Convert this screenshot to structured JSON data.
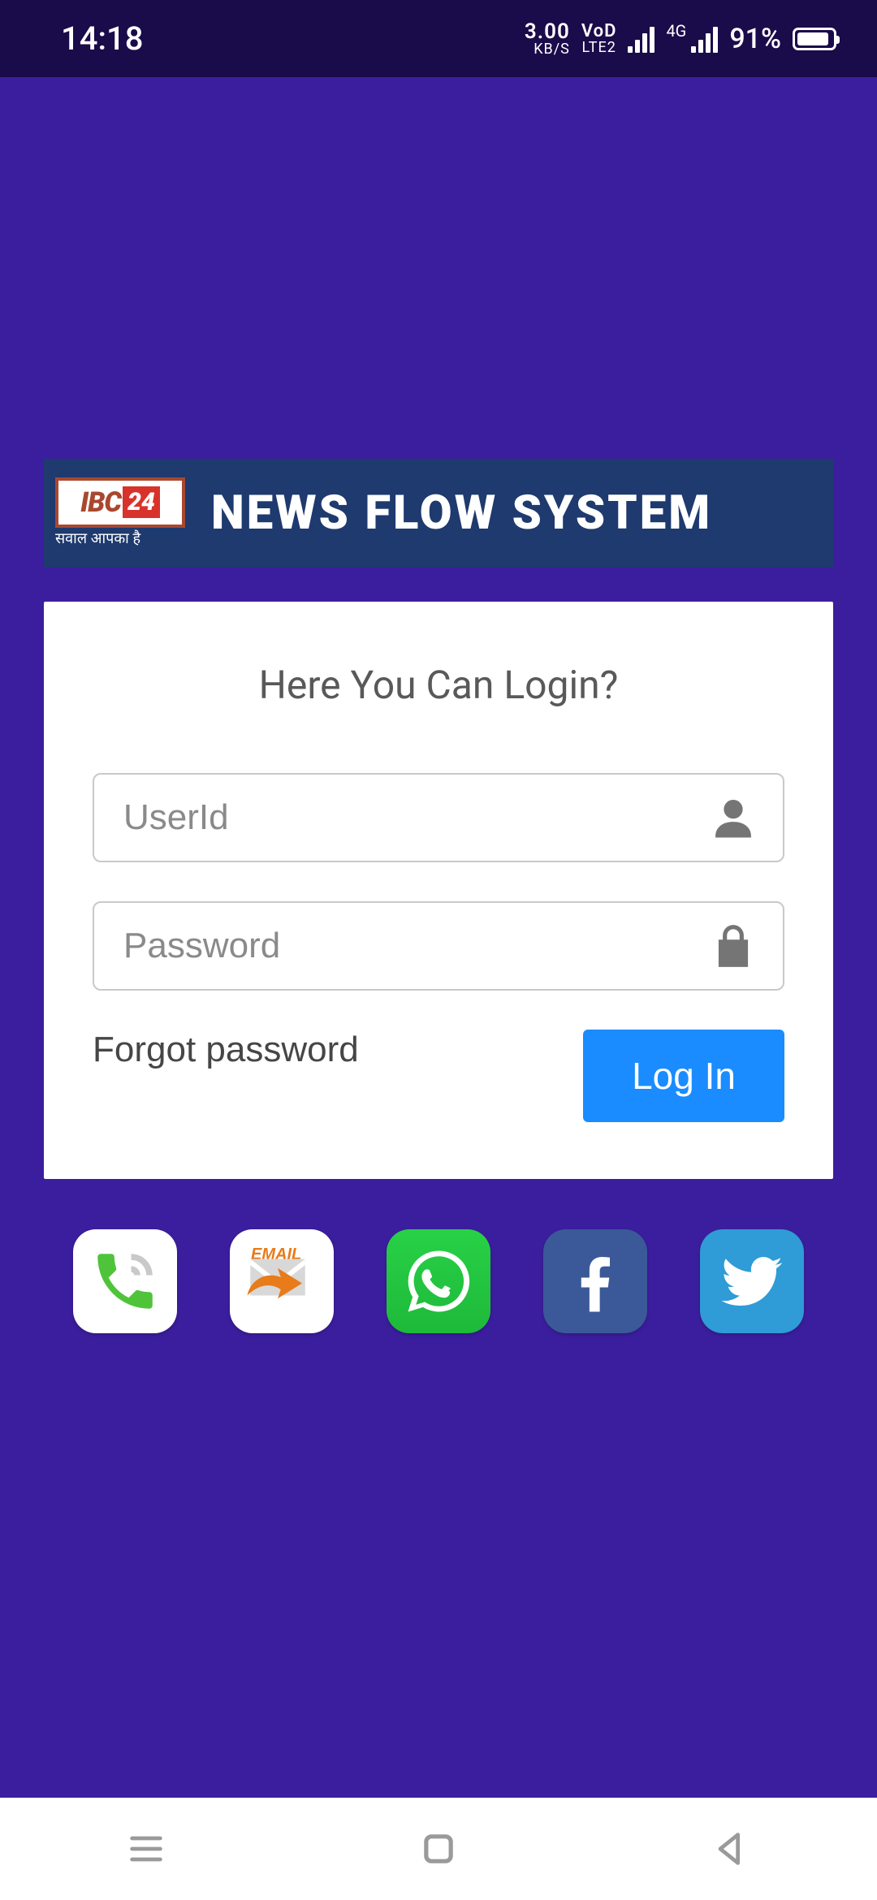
{
  "status": {
    "time": "14:18",
    "net_speed_value": "3.00",
    "net_speed_unit": "KB/S",
    "net_label_top": "VoD",
    "net_label_bottom": "LTE2",
    "net_tag": "4G",
    "battery_pct": "91%"
  },
  "banner": {
    "logo_text_a": "IBC",
    "logo_text_b": "24",
    "logo_tagline": "सवाल आपका है",
    "title": "NEWS FLOW SYSTEM"
  },
  "login": {
    "heading": "Here You Can Login?",
    "userid_placeholder": "UserId",
    "password_placeholder": "Password",
    "forgot_label": "Forgot password",
    "submit_label": "Log In"
  },
  "social": {
    "call_name": "call-icon",
    "email_tag": "EMAIL",
    "whatsapp_name": "whatsapp-icon",
    "facebook_name": "facebook-icon",
    "twitter_name": "twitter-icon"
  }
}
